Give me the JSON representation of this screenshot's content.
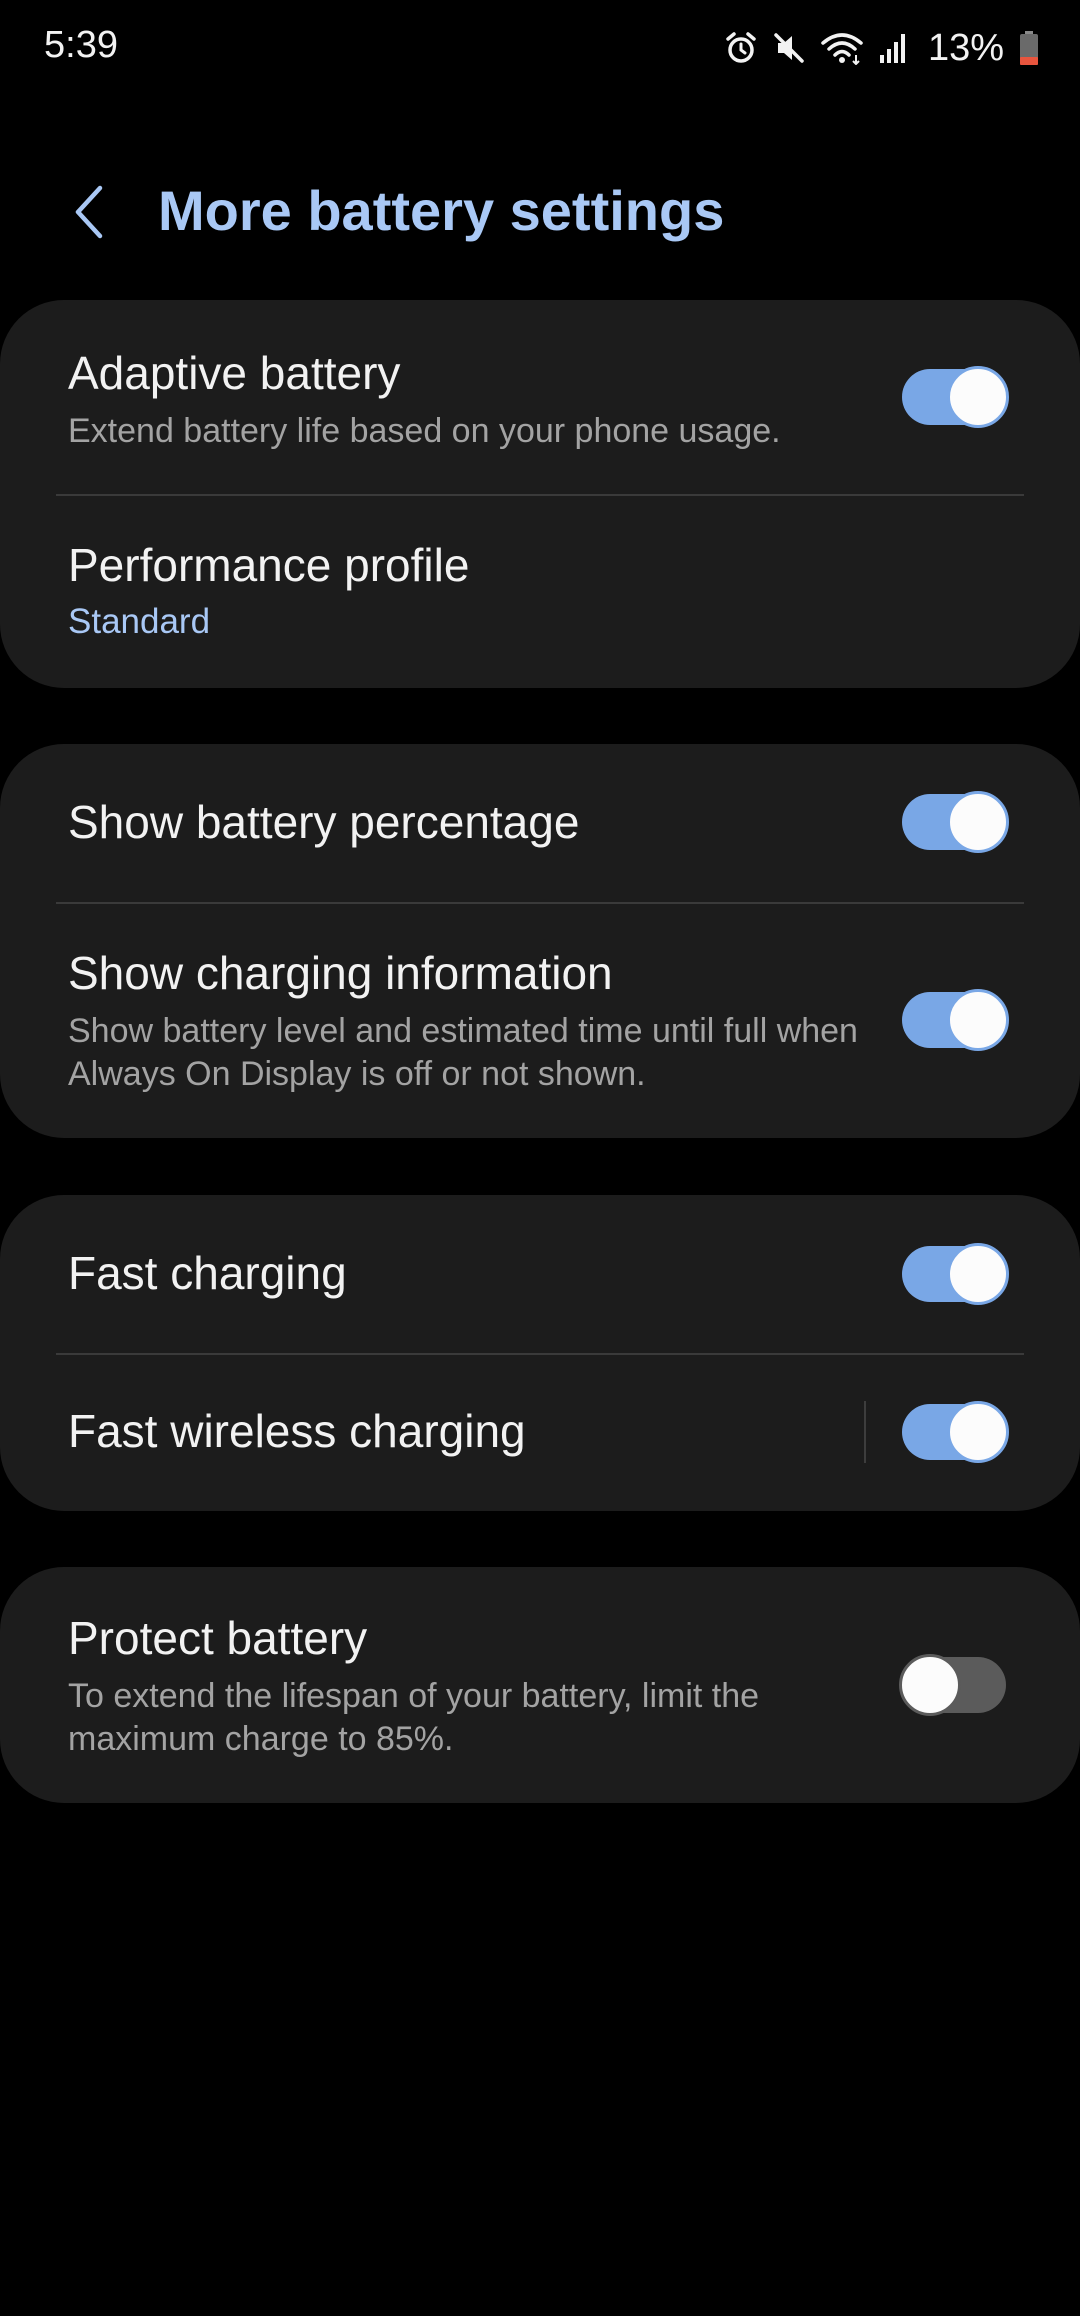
{
  "status_bar": {
    "time": "5:39",
    "battery_percent": "13%",
    "icons": [
      "alarm-icon",
      "mute-icon",
      "wifi-icon",
      "signal-icon",
      "battery-icon"
    ]
  },
  "header": {
    "title": "More battery settings",
    "back_icon": "chevron-left-icon"
  },
  "colors": {
    "accent": "#a9c8f5",
    "toggle_on": "#79a7e6",
    "toggle_off": "#5b5b5b",
    "card_bg": "#1c1c1c",
    "battery_low": "#e8553e"
  },
  "settings": {
    "adaptive_battery": {
      "title": "Adaptive battery",
      "subtitle": "Extend battery life based on your phone usage.",
      "enabled": true
    },
    "performance_profile": {
      "title": "Performance profile",
      "value": "Standard"
    },
    "show_battery_percentage": {
      "title": "Show battery percentage",
      "enabled": true
    },
    "show_charging_information": {
      "title": "Show charging information",
      "subtitle": "Show battery level and estimated time until full when Always On Display is off or not shown.",
      "enabled": true
    },
    "fast_charging": {
      "title": "Fast charging",
      "enabled": true
    },
    "fast_wireless_charging": {
      "title": "Fast wireless charging",
      "enabled": true
    },
    "protect_battery": {
      "title": "Protect battery",
      "subtitle": "To extend the lifespan of your battery, limit the maximum charge to 85%.",
      "enabled": false
    }
  }
}
